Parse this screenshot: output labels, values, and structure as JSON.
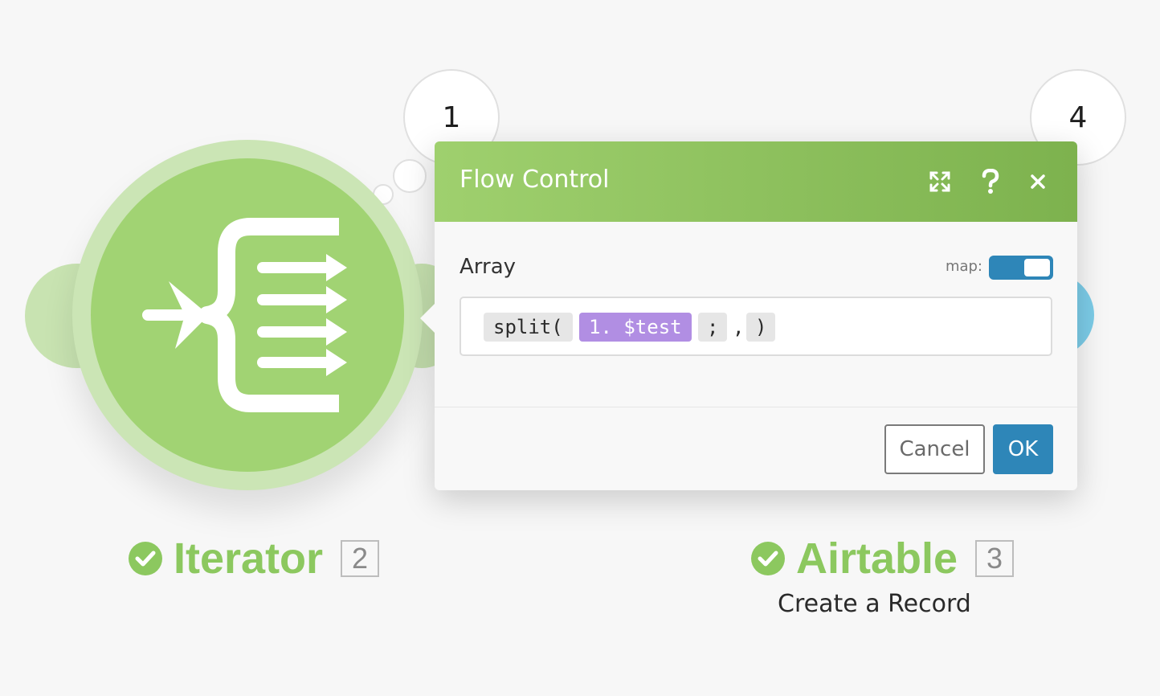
{
  "bubbles": {
    "iterator_count": "1",
    "airtable_count": "4"
  },
  "modules": {
    "iterator": {
      "name": "Iterator",
      "number": "2",
      "status_icon": "check-circle-icon",
      "icon": "iterator-icon",
      "color": "#a1d373"
    },
    "airtable": {
      "name": "Airtable",
      "number": "3",
      "subtitle": "Create a Record",
      "status_icon": "check-circle-icon"
    }
  },
  "dialog": {
    "title": "Flow Control",
    "header_icons": [
      "expand-icon",
      "help-icon",
      "close-icon"
    ],
    "field": {
      "label": "Array",
      "map_label": "map:",
      "map_enabled": true,
      "tokens": [
        {
          "text": "split(",
          "kind": "function"
        },
        {
          "text": "1. $test",
          "kind": "variable"
        },
        {
          "text": ";",
          "kind": "argument"
        },
        {
          "text": ",",
          "kind": "separator"
        },
        {
          "text": ")",
          "kind": "function"
        }
      ]
    },
    "buttons": {
      "cancel": "Cancel",
      "ok": "OK"
    }
  },
  "colors": {
    "header_gradient_start": "#9fd06e",
    "header_gradient_end": "#7db24e",
    "accent_blue": "#2e86b8",
    "variable_purple": "#b18ee3",
    "module_green": "#8cc85f"
  }
}
